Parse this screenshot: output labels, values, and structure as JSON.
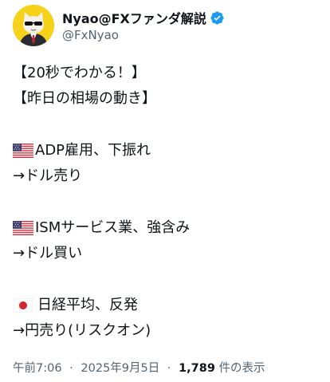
{
  "author": {
    "display_name": "Nyao@FXファンダ解説",
    "handle": "@FxNyao",
    "verified": true,
    "verified_color": "#1d9bf0",
    "avatar_bg": "#f6d21b"
  },
  "tweet": {
    "lines": [
      {
        "text": "【20秒でわかる！】"
      },
      {
        "text": "【昨日の相場の動き】"
      },
      {
        "flag": "us-flag-icon",
        "text": "ADP雇用、下振れ"
      },
      {
        "text": "→ドル売り"
      },
      {
        "flag": "us-flag-icon",
        "text": "ISMサービス業、強含み"
      },
      {
        "text": "→ドル買い"
      },
      {
        "flag": "jp-flag-icon",
        "text": "日経平均、反発"
      },
      {
        "text": "→円売り(リスクオン)"
      }
    ]
  },
  "meta": {
    "time": "午前7:06",
    "separator": "·",
    "date": "2025年9月5日",
    "views_count": "1,789",
    "views_label": "件の表示"
  }
}
